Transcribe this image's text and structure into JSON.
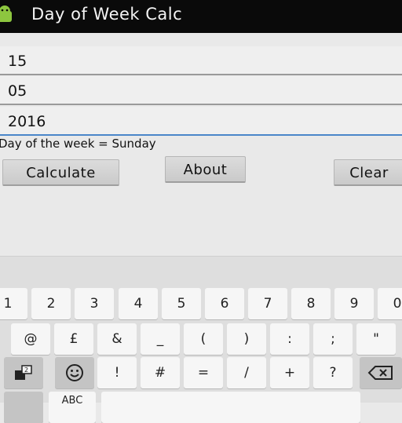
{
  "app": {
    "title": "Day of Week Calc"
  },
  "form": {
    "day": "15",
    "month": "05",
    "year": "2016",
    "result": "Day of the week = Sunday"
  },
  "buttons": {
    "calculate": "Calculate",
    "about": "About",
    "clear": "Clear"
  },
  "keyboard": {
    "row1": [
      "1",
      "2",
      "3",
      "4",
      "5",
      "6",
      "7",
      "8",
      "9",
      "0"
    ],
    "row2": [
      "@",
      "£",
      "&",
      "_",
      "(",
      ")",
      ":",
      ";",
      "\""
    ],
    "row3": [
      "!",
      "#",
      "=",
      "/",
      "+",
      "?"
    ],
    "icons": {
      "shift_key": "symbols-shift-icon",
      "emoji_key": "smiley-icon",
      "delete_key": "backspace-icon"
    },
    "bottom_partial": "ABC"
  },
  "colors": {
    "titlebar": "#0a0a0a",
    "focus_underline": "#4a86c9",
    "background": "#e9e9e9"
  }
}
